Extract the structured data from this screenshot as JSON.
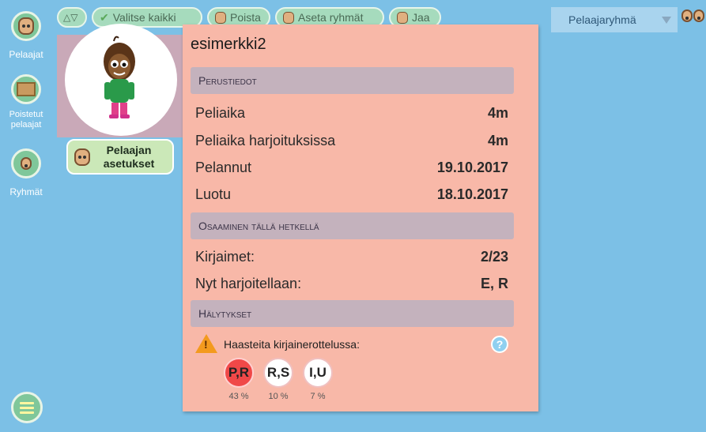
{
  "sidebar": {
    "players_label": "Pelaajat",
    "removed_label": "Poistetut pelaajat",
    "groups_label": "Ryhmät"
  },
  "toolbar": {
    "select_all": "Valitse kaikki",
    "delete": "Poista",
    "set_groups": "Aseta ryhmät",
    "share": "Jaa"
  },
  "group_select": {
    "value": "Pelaajaryhmä"
  },
  "player_settings": {
    "label": "Pelaajan asetukset"
  },
  "player": {
    "name": "esimerkki2",
    "section_basic": "Perustiedot",
    "section_skills": "Osaaminen tällä hetkellä",
    "section_alerts": "Hälytykset",
    "rows": [
      {
        "label": "Peliaika",
        "value": "4m"
      },
      {
        "label": "Peliaika harjoituksissa",
        "value": "4m"
      },
      {
        "label": "Pelannut",
        "value": "19.10.2017"
      },
      {
        "label": "Luotu",
        "value": "18.10.2017"
      }
    ],
    "skills": [
      {
        "label": "Kirjaimet:",
        "value": "2/23"
      },
      {
        "label": "Nyt harjoitellaan:",
        "value": "E, R"
      }
    ],
    "alert_text": "Haasteita kirjainerottelussa:",
    "pairs": [
      {
        "label": "P,R",
        "pct": "43 %",
        "color": "#f04848"
      },
      {
        "label": "R,S",
        "pct": "10 %",
        "color": "#ffffff"
      },
      {
        "label": "I,U",
        "pct": "7 %",
        "color": "#ffffff"
      }
    ]
  },
  "colors": {
    "background": "#7cc0e6",
    "panel": "#f8b8a8",
    "accent_green": "#7fc79a",
    "warning": "#f39a1e"
  }
}
